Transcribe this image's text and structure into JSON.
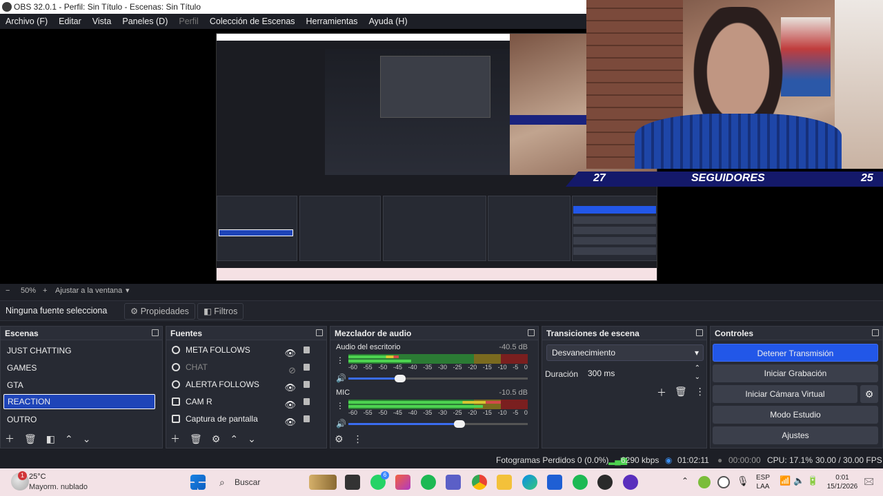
{
  "window": {
    "title": "OBS 32.0.1 - Perfil: Sin Título - Escenas: Sin Título"
  },
  "menu": [
    "Archivo (F)",
    "Editar",
    "Vista",
    "Paneles (D)",
    "Perfil",
    "Colección de Escenas",
    "Herramientas",
    "Ayuda (H)"
  ],
  "overlay": {
    "left_count": "27",
    "label": "SEGUIDORES",
    "right_count": "25"
  },
  "zoom": {
    "minus": "−",
    "value": "50%",
    "plus": "+",
    "fit": "Ajustar a la ventana"
  },
  "props": {
    "no_source": "Ninguna fuente selecciona",
    "properties": "Propiedades",
    "filters": "Filtros"
  },
  "scenes": {
    "title": "Escenas",
    "items": [
      "JUST CHATTING",
      "GAMES",
      "GTA",
      "REACTION",
      "OUTRO"
    ],
    "selected": "REACTION"
  },
  "sources": {
    "title": "Fuentes",
    "items": [
      {
        "name": "META FOLLOWS",
        "visible": true
      },
      {
        "name": "CHAT",
        "visible": false
      },
      {
        "name": "ALERTA FOLLOWS",
        "visible": true
      },
      {
        "name": "CAM R",
        "visible": true
      },
      {
        "name": "Captura de pantalla",
        "visible": true
      }
    ]
  },
  "mixer": {
    "title": "Mezclador de audio",
    "ticks": [
      "-60",
      "-55",
      "-50",
      "-45",
      "-40",
      "-35",
      "-30",
      "-25",
      "-20",
      "-15",
      "-10",
      "-5",
      "0"
    ],
    "channels": [
      {
        "name": "Audio del escritorio",
        "level": "-40.5 dB",
        "volume": 0.29
      },
      {
        "name": "MIC",
        "level": "-10.5 dB",
        "volume": 0.62
      }
    ]
  },
  "transitions": {
    "title": "Transiciones de escena",
    "selected": "Desvanecimiento",
    "duration_label": "Duración",
    "duration_value": "300 ms"
  },
  "controls": {
    "title": "Controles",
    "buttons": [
      "Detener Transmisión",
      "Iniciar Grabación",
      "Iniciar Cámara Virtual",
      "Modo Estudio",
      "Ajustes"
    ]
  },
  "status": {
    "dropped": "Fotogramas Perdidos 0 (0.0%)",
    "bitrate": "6290 kbps",
    "stream_time": "01:02:11",
    "rec_time": "00:00:00",
    "cpu": "CPU: 17.1%",
    "fps": "30.00 / 30.00 FPS"
  },
  "taskbar": {
    "temp": "25°C",
    "weather": "Mayorm. nublado",
    "notif": "1",
    "search": "Buscar",
    "lang1": "ESP",
    "lang2": "LAA",
    "time": "0:01",
    "date": "15/1/2026",
    "whatsapp_badge": "6"
  },
  "colors": {
    "accent": "#2257e8",
    "bg": "#1d1f26",
    "panel": "#272a33"
  }
}
